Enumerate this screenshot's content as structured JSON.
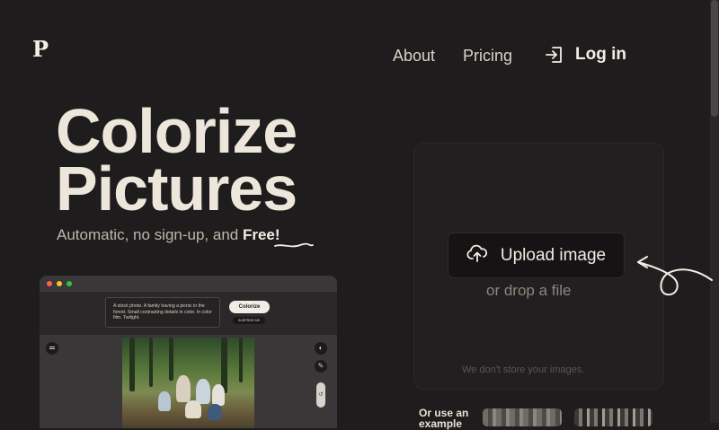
{
  "brand": {
    "logo_text": "P"
  },
  "nav": {
    "about": "About",
    "pricing": "Pricing",
    "login": "Log in",
    "login_icon": "login-icon"
  },
  "hero": {
    "title_line1": "Colorize",
    "title_line2": "Pictures",
    "subtitle_prefix": "Automatic, no sign-up, and ",
    "subtitle_emphasis": "Free!"
  },
  "preview": {
    "prompt_text": "A stock photo. A family having a picnic in the forest. Small contrasting details in color. In color film. Twilight.",
    "colorize_label": "Colorize",
    "surprise_label": "SURPRISE ME",
    "window_dots": [
      "#ff5f57",
      "#febc2e",
      "#28c840"
    ],
    "tool_icons": [
      "menu-icon",
      "palette-icon",
      "pencil-icon",
      "undo-icon"
    ]
  },
  "upload": {
    "button_label": "Upload image",
    "button_icon": "cloud-upload-icon",
    "drop_text": "or drop a file",
    "privacy_note": "We don't store your images."
  },
  "examples": {
    "label_line1": "Or use an",
    "label_line2": "example"
  },
  "colors": {
    "background": "#1f1c1d",
    "panel": "#221f20",
    "text_primary": "#ece6db"
  }
}
